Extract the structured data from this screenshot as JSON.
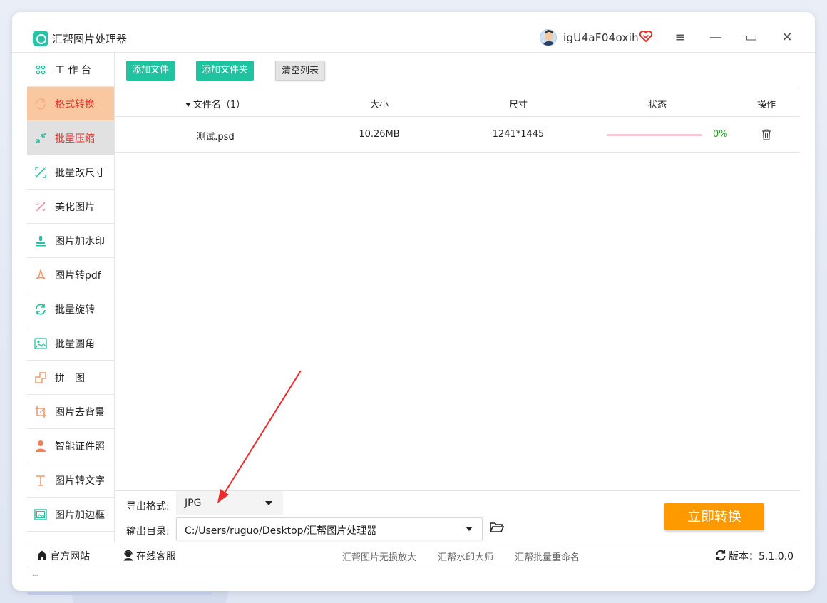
{
  "app": {
    "title": "汇帮图片处理器",
    "username": "igU4aF04oxih"
  },
  "window_controls": {
    "menu": "≡",
    "minimize": "—",
    "maximize": "▭",
    "close": "✕"
  },
  "sidebar": {
    "items": [
      {
        "label": "工 作 台",
        "icon": "grid-icon",
        "color": "#20c3a0"
      },
      {
        "label": "格式转换",
        "icon": "format-convert-icon",
        "color": "#f39a6b"
      },
      {
        "label": "批量压缩",
        "icon": "compress-icon",
        "color": "#20c3a0"
      },
      {
        "label": "批量改尺寸",
        "icon": "resize-icon",
        "color": "#20c3a0"
      },
      {
        "label": "美化图片",
        "icon": "beautify-icon",
        "color": "#f08aa0"
      },
      {
        "label": "图片加水印",
        "icon": "watermark-icon",
        "color": "#20c3a0"
      },
      {
        "label": "图片转pdf",
        "icon": "pdf-icon",
        "color": "#f39a6b"
      },
      {
        "label": "批量旋转",
        "icon": "rotate-icon",
        "color": "#20c3a0"
      },
      {
        "label": "批量圆角",
        "icon": "image-rounded-icon",
        "color": "#20c3a0"
      },
      {
        "label": "拼　图",
        "icon": "puzzle-icon",
        "color": "#f39a6b"
      },
      {
        "label": "图片去背景",
        "icon": "crop-icon",
        "color": "#f39a6b"
      },
      {
        "label": "智能证件照",
        "icon": "person-icon",
        "color": "#f07f5a"
      },
      {
        "label": "图片转文字",
        "icon": "text-icon",
        "color": "#f39a6b"
      },
      {
        "label": "图片加边框",
        "icon": "frame-icon",
        "color": "#20c3a0"
      }
    ]
  },
  "toolbar": {
    "add_file": "添加文件",
    "add_folder": "添加文件夹",
    "clear_list": "清空列表"
  },
  "table": {
    "headers": {
      "filename": "文件名（1）",
      "size": "大小",
      "dimensions": "尺寸",
      "status": "状态",
      "action": "操作"
    },
    "rows": [
      {
        "filename": "测试.psd",
        "size": "10.26MB",
        "dimensions": "1241*1445",
        "progress_label": "0%",
        "progress": 0
      }
    ]
  },
  "export": {
    "format_label": "导出格式:",
    "format_value": "JPG",
    "output_label": "输出目录:",
    "output_value": "C:/Users/ruguo/Desktop/汇帮图片处理器",
    "convert_button": "立即转换"
  },
  "footer": {
    "website": "官方网站",
    "support": "在线客服",
    "links": [
      "汇帮图片无损放大",
      "汇帮水印大师",
      "汇帮批量重命名"
    ],
    "version_label": "版本：",
    "version": "5.1.0.0"
  },
  "colors": {
    "accent_green": "#20c3a0",
    "accent_orange": "#ff9900",
    "active_bg": "#f9c8a0",
    "active_text": "#e5302a"
  }
}
